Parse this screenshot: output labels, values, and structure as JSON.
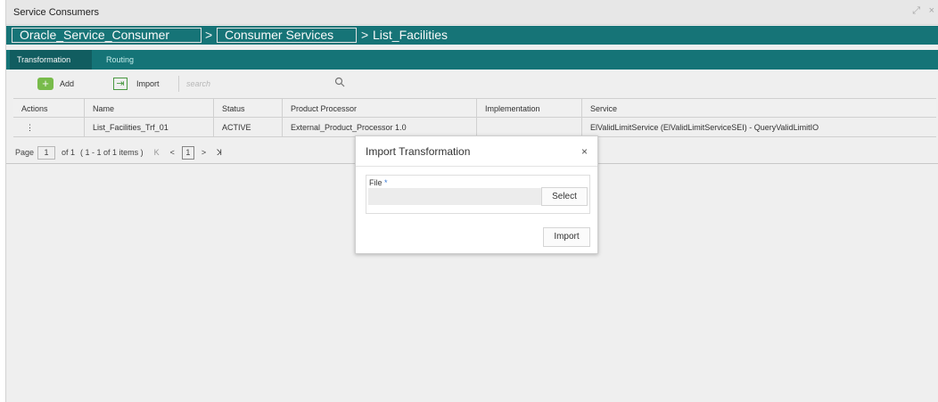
{
  "window": {
    "title": "Service Consumers",
    "controls": [
      "⤢",
      "×"
    ]
  },
  "breadcrumb": {
    "items": [
      "Oracle_Service_Consumer",
      "Consumer Services",
      "List_Facilities"
    ],
    "separator": ">"
  },
  "tabs": [
    {
      "label": "Transformation",
      "active": true
    },
    {
      "label": "Routing",
      "active": false
    }
  ],
  "toolbar": {
    "add_label": "Add",
    "import_label": "Import",
    "search_placeholder": "search"
  },
  "table": {
    "columns": [
      "Actions",
      "Name",
      "Status",
      "Product Processor",
      "Implementation",
      "Service"
    ],
    "rows": [
      {
        "actions": "⋮",
        "name": "List_Facilities_Trf_01",
        "status": "ACTIVE",
        "product_processor": "External_Product_Processor 1.0",
        "implementation": "",
        "service": "ElValidLimitService (ElValidLimitServiceSEI) - QueryValidLimitIO"
      }
    ]
  },
  "pagination": {
    "page_label": "Page",
    "page_value": "1",
    "of_text": "of 1",
    "items_text": "( 1 - 1 of 1 items )",
    "current_page": "1",
    "first": "K",
    "prev": "<",
    "next": ">",
    "last": "ꓘ"
  },
  "modal": {
    "title": "Import Transformation",
    "close": "×",
    "file_label": "File",
    "required_mark": "*",
    "select_label": "Select",
    "import_label": "Import"
  }
}
